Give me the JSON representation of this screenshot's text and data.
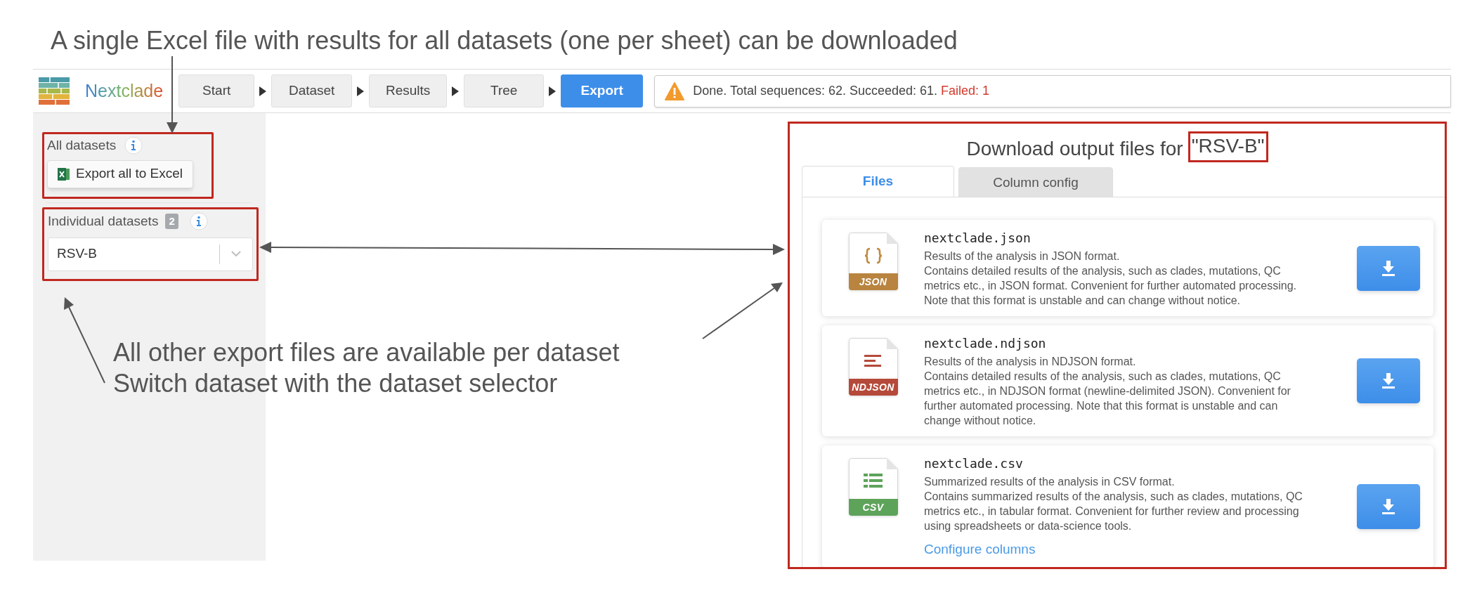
{
  "annotations": {
    "caption": "A single Excel file with results for all datasets (one per sheet) can be downloaded",
    "note_lines": [
      "All other export files are available per dataset",
      "Switch dataset with the dataset selector"
    ]
  },
  "logo": {
    "name": "Nextclade"
  },
  "steps": [
    {
      "label": "Start",
      "selected": false
    },
    {
      "label": "Dataset",
      "selected": false
    },
    {
      "label": "Results",
      "selected": false
    },
    {
      "label": "Tree",
      "selected": false
    },
    {
      "label": "Export",
      "selected": true
    }
  ],
  "status": {
    "message": "Done. Total sequences: 62. Succeeded: 61.",
    "failed": "Failed: 1"
  },
  "sidebar": {
    "all_datasets": {
      "label": "All datasets",
      "button": "Export all to Excel"
    },
    "individual_datasets": {
      "label": "Individual datasets",
      "count": "2",
      "selected_dataset": "RSV-B"
    }
  },
  "downloads": {
    "title": "Download output files for",
    "dataset": "\"RSV-B\"",
    "tabs": [
      {
        "label": "Files",
        "selected": true
      },
      {
        "label": "Column config",
        "selected": false
      }
    ],
    "files": [
      {
        "kind": "json",
        "filename": "nextclade.json",
        "badge": "JSON",
        "summary": "Results of the analysis in JSON format.",
        "description": "Contains detailed results of the analysis, such as clades, mutations, QC metrics etc., in JSON format. Convenient for further automated processing. Note that this format is unstable and can change without notice."
      },
      {
        "kind": "ndjson",
        "filename": "nextclade.ndjson",
        "badge": "NDJSON",
        "summary": "Results of the analysis in NDJSON format.",
        "description": "Contains detailed results of the analysis, such as clades, mutations, QC metrics etc., in NDJSON format (newline-delimited JSON). Convenient for further automated processing. Note that this format is unstable and can change without notice."
      },
      {
        "kind": "csv",
        "filename": "nextclade.csv",
        "badge": "CSV",
        "summary": "Summarized results of the analysis in CSV format.",
        "description": "Contains summarized results of the analysis, such as clades, mutations, QC metrics etc., in tabular format. Convenient for further review and processing using spreadsheets or data-science tools.",
        "link": "Configure columns"
      }
    ]
  }
}
